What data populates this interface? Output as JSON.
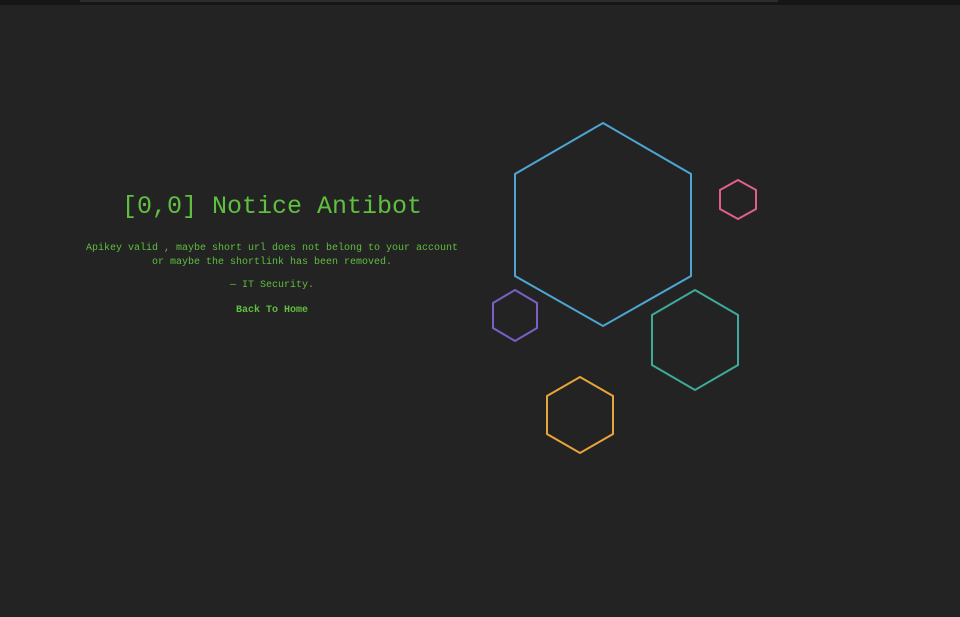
{
  "notice": {
    "title": "[0,0] Notice Antibot",
    "message_line1": "Apikey valid , maybe short url does not belong to your account",
    "message_line2": "or maybe the shortlink has been removed.",
    "signature": "— IT Security.",
    "back_link": "Back To Home"
  },
  "colors": {
    "background": "#232323",
    "text": "#5fbf3f",
    "hex_blue": "#4ea5d3",
    "hex_pink": "#e05f8d",
    "hex_teal": "#3fa99a",
    "hex_purple": "#7a5fc4",
    "hex_orange": "#e8a43a"
  }
}
